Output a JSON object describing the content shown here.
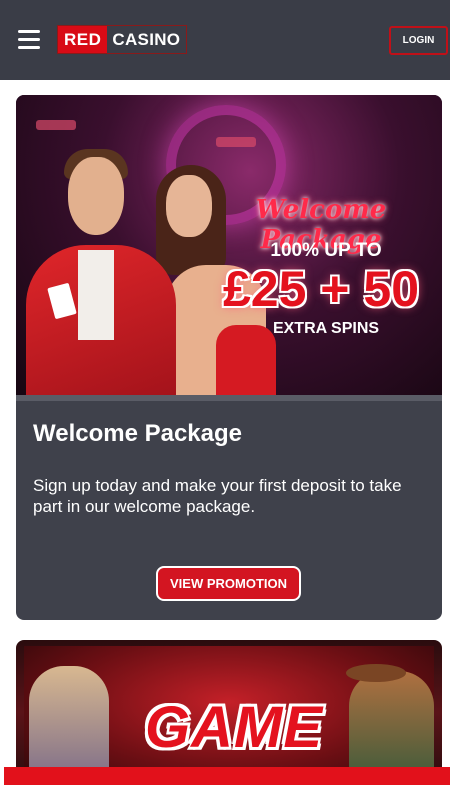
{
  "header": {
    "logo_red": "RED",
    "logo_casino": "CASINO",
    "login_label": "LOGIN",
    "menu_icon": "hamburger-menu-icon"
  },
  "promo": {
    "banner": {
      "script_title": "Welcome Package",
      "line1": "100% UP TO",
      "amount": "£25 + 50",
      "line3": "EXTRA SPINS"
    },
    "title": "Welcome Package",
    "description": "Sign up today and make your first deposit to take part in our welcome package.",
    "button_label": "VIEW PROMOTION"
  },
  "promo2": {
    "banner_word": "GAME"
  },
  "colors": {
    "header_bg": "#3a3d47",
    "card_bg": "#3f414b",
    "brand_red": "#d80b16"
  }
}
